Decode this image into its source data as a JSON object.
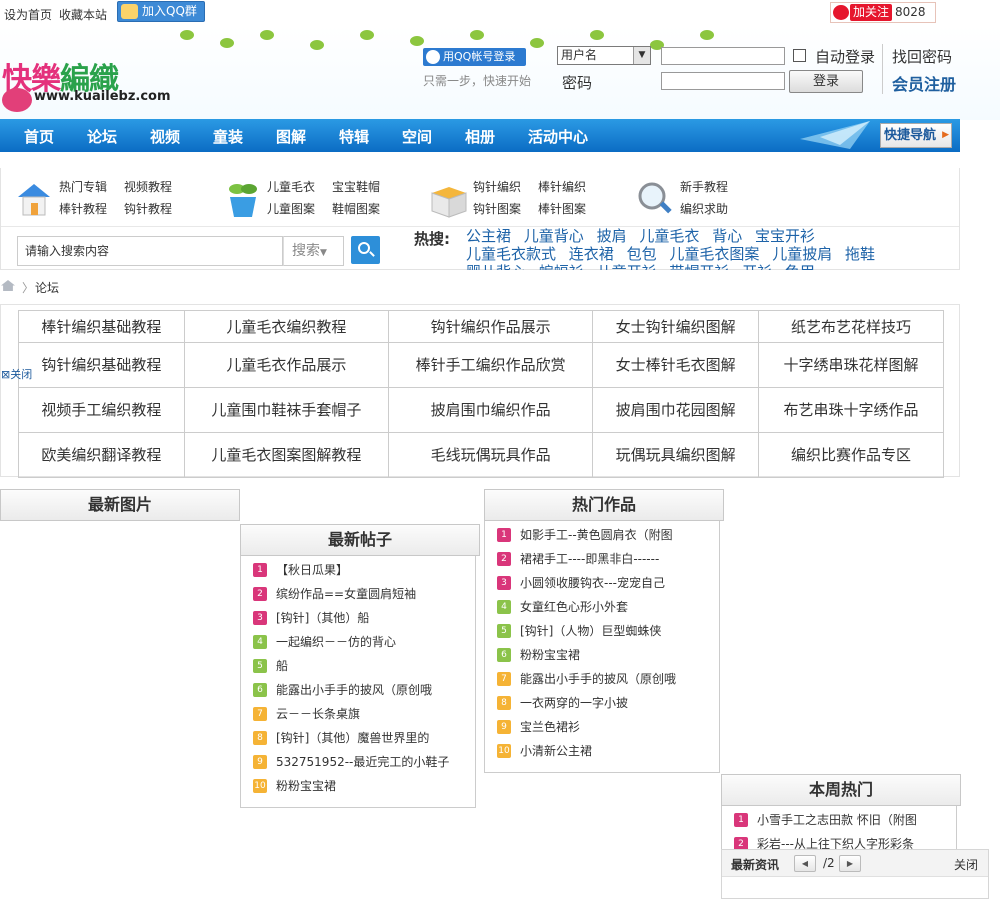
{
  "topbar": {
    "set_home": "设为首页",
    "bookmark": "收藏本站",
    "qq_group": "加入QQ群",
    "weibo_follow": "加关注",
    "weibo_count": "8028"
  },
  "header": {
    "logo_text_a": "快樂",
    "logo_text_b": "編織",
    "logo_url": "www.kuailebz.com",
    "qq_login": "用QQ帐号登录",
    "qq_tip": "只需一步，快速开始",
    "user_type": "用户名",
    "auto_login": "自动登录",
    "find_password": "找回密码",
    "password_label": "密码",
    "login_button": "登录",
    "register": "会员注册"
  },
  "nav": {
    "items": [
      "首页",
      "论坛",
      "视频",
      "童装",
      "图解",
      "特辑",
      "空间",
      "相册",
      "活动中心"
    ],
    "quick": "快捷导航"
  },
  "categories": [
    {
      "links": [
        "热门专辑",
        "视频教程",
        "棒针教程",
        "钩针教程"
      ],
      "icon": "house-icon"
    },
    {
      "links": [
        "儿童毛衣",
        "宝宝鞋帽",
        "儿童图案",
        "鞋帽图案"
      ],
      "icon": "plant-icon"
    },
    {
      "links": [
        "钩针编织",
        "棒针编织",
        "钩针图案",
        "棒针图案"
      ],
      "icon": "box-icon"
    },
    {
      "links": [
        "新手教程",
        "编织求助"
      ],
      "icon": "magnifier-icon"
    }
  ],
  "search": {
    "placeholder": "请输入搜索内容",
    "scope": "搜索",
    "hot_label": "热搜:",
    "hot_words": [
      "公主裙",
      "儿童背心",
      "披肩",
      "儿童毛衣",
      "背心",
      "宝宝开衫",
      "儿童毛衣款式",
      "连衣裙",
      "包包",
      "儿童毛衣图案",
      "儿童披肩",
      "拖鞋",
      "婴儿背心",
      "蝙蝠衫",
      "儿童开衫",
      "带帽开衫",
      "开衫",
      "龟甲..."
    ]
  },
  "breadcrumb": {
    "current": "论坛"
  },
  "forum_close": "关闭",
  "forum_table": [
    [
      "棒针编织基础教程",
      "儿童毛衣编织教程",
      "钩针编织作品展示",
      "女士钩针编织图解",
      "纸艺布艺花样技巧"
    ],
    [
      "钩针编织基础教程",
      "儿童毛衣作品展示",
      "棒针手工编织作品欣赏",
      "女士棒针毛衣图解",
      "十字绣串珠花样图解"
    ],
    [
      "视频手工编织教程",
      "儿童围巾鞋袜手套帽子",
      "披肩围巾编织作品",
      "披肩围巾花园图解",
      "布艺串珠十字绣作品"
    ],
    [
      "欧美编织翻译教程",
      "儿童毛衣图案图解教程",
      "毛线玩偶玩具作品",
      "玩偶玩具编织图解",
      "编织比赛作品专区"
    ]
  ],
  "panels": {
    "latest_images": {
      "title": "最新图片"
    },
    "latest_posts": {
      "title": "最新帖子",
      "items": [
        "【秋日瓜果】",
        "缤纷作品==女童圆肩短袖",
        "[钩针]（其他）船",
        "一起编织－－仿的背心",
        "船",
        "能露出小手手的披风（原创哦",
        "云－－长条桌旗",
        "[钩针]（其他）魔兽世界里的",
        "532751952--最近完工的小鞋子",
        "粉粉宝宝裙"
      ]
    },
    "hot_works": {
      "title": "热门作品",
      "items": [
        "如影手工--黄色圆肩衣（附图",
        "裙裙手工----即黑非白------",
        "小圆领收腰钩衣---宠宠自己",
        "女童红色心形小外套",
        "[钩针]（人物）巨型蜘蛛侠",
        "粉粉宝宝裙",
        "能露出小手手的披风（原创哦",
        "一衣两穿的一字小披",
        "宝兰色裙衫",
        "小清新公主裙"
      ]
    },
    "weekly_hot": {
      "title": "本周热门",
      "items": [
        "小雪手工之志田款 怀旧（附图",
        "彩岩---从上往下织人字形彩条"
      ]
    }
  },
  "news_bar": {
    "title": "最新资讯",
    "page": "/2",
    "close": "关闭"
  },
  "colors": {
    "nav_blue": "#1383d6",
    "rank_top3": "#d9367a",
    "rank_4_6": "#8bc34a",
    "rank_7_10": "#f5b335",
    "link_blue": "#1e63a8"
  }
}
